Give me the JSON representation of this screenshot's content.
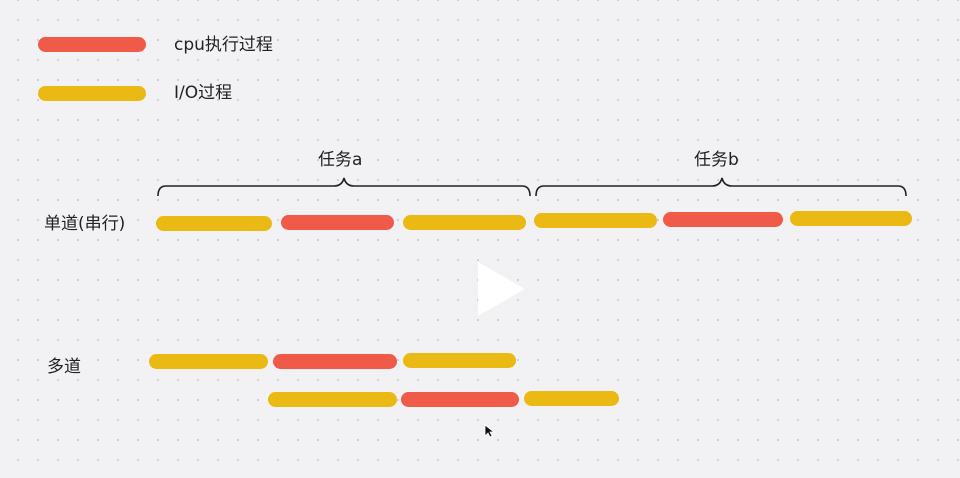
{
  "legend": {
    "cpu_label": "cpu执行过程",
    "io_label": "I/O过程",
    "cpu_color": "#f05a48",
    "io_color": "#ebb914"
  },
  "tasks": {
    "task_a_label": "任务a",
    "task_b_label": "任务b"
  },
  "rows": {
    "serial_label": "单道(串行)",
    "multi_label": "多道"
  },
  "segments": {
    "serial": [
      "I/O",
      "cpu",
      "I/O",
      "I/O",
      "cpu",
      "I/O"
    ],
    "multi_task_a": [
      "I/O",
      "cpu",
      "I/O"
    ],
    "multi_task_b": [
      "I/O",
      "cpu",
      "I/O"
    ]
  },
  "overlay": {
    "play_icon": "play-icon",
    "cursor_icon": "mouse-cursor-icon"
  }
}
